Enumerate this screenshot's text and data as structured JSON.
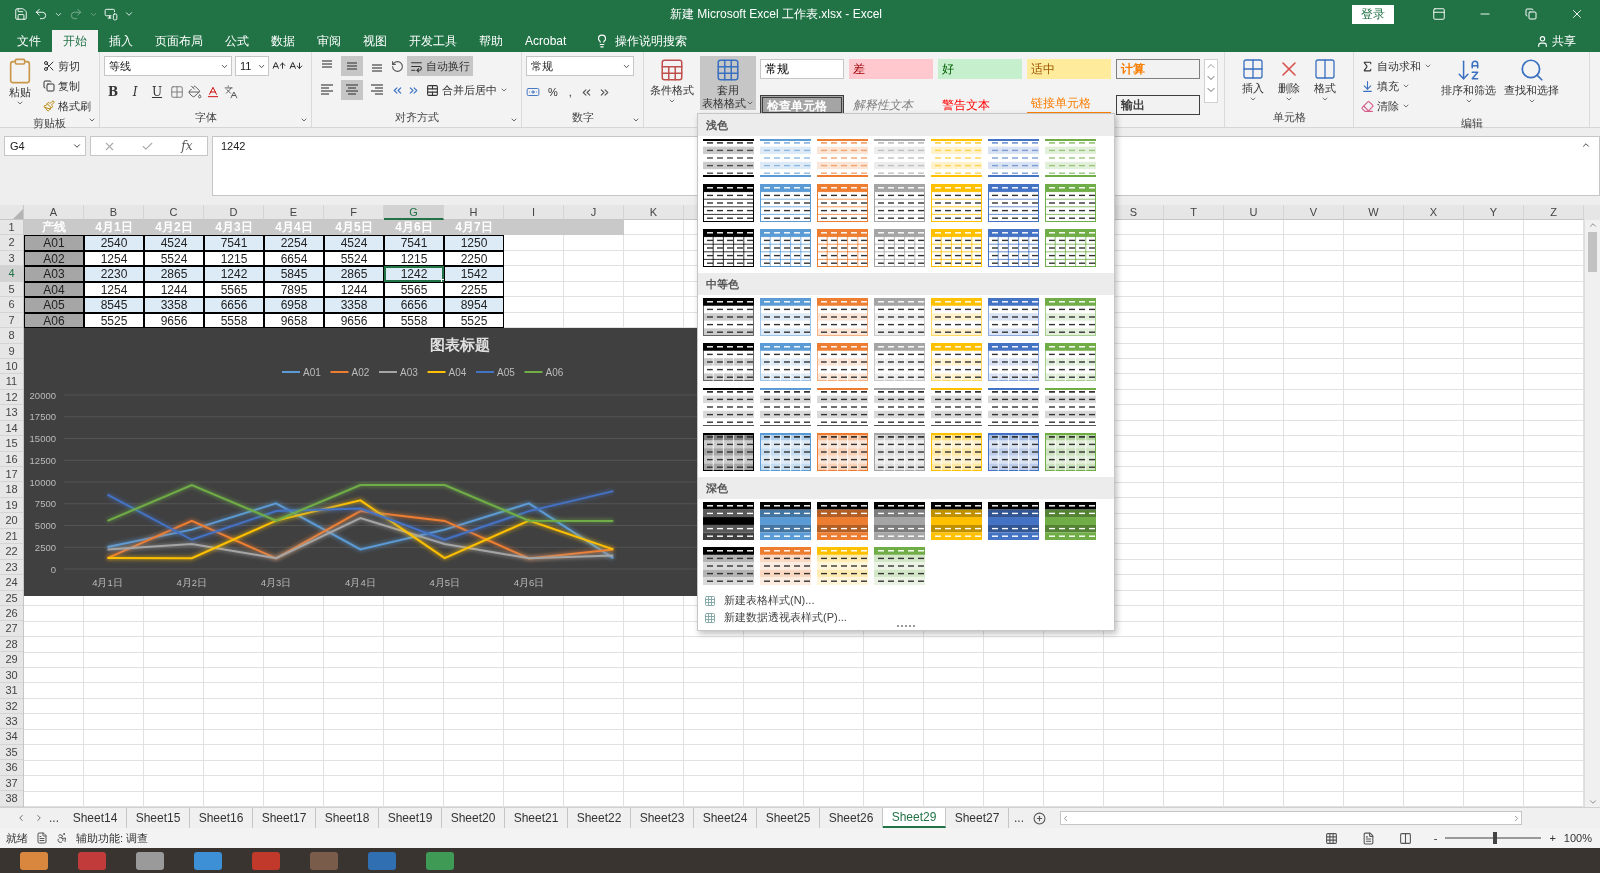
{
  "window": {
    "title": "新建 Microsoft Excel 工作表.xlsx  -  Excel",
    "sign_in": "登录"
  },
  "menu_tabs": [
    {
      "label": "文件",
      "selected": false
    },
    {
      "label": "开始",
      "selected": true
    },
    {
      "label": "插入",
      "selected": false
    },
    {
      "label": "页面布局",
      "selected": false
    },
    {
      "label": "公式",
      "selected": false
    },
    {
      "label": "数据",
      "selected": false
    },
    {
      "label": "审阅",
      "selected": false
    },
    {
      "label": "视图",
      "selected": false
    },
    {
      "label": "开发工具",
      "selected": false
    },
    {
      "label": "帮助",
      "selected": false
    },
    {
      "label": "Acrobat",
      "selected": false
    }
  ],
  "tell_me": "操作说明搜索",
  "share": "共享",
  "ribbon": {
    "clipboard": {
      "label": "剪贴板",
      "paste": "粘贴",
      "cut": "剪切",
      "copy": "复制",
      "format_painter": "格式刷"
    },
    "font": {
      "label": "字体",
      "font_name": "等线",
      "font_size": "11",
      "bold": "B",
      "italic": "I",
      "underline": "U"
    },
    "alignment": {
      "label": "对齐方式",
      "vertical": [
        {
          "kind": "top",
          "on": false
        },
        {
          "kind": "middle",
          "on": true
        },
        {
          "kind": "bottom",
          "on": false
        }
      ],
      "horizontal": [
        {
          "kind": "left",
          "on": false
        },
        {
          "kind": "center",
          "on": true
        },
        {
          "kind": "right",
          "on": false
        }
      ],
      "wrap_text": {
        "label": "自动换行",
        "on": true
      },
      "merge_center": "合并后居中"
    },
    "number": {
      "label": "数字",
      "format": "常规",
      "percent": "%",
      "comma": ","
    },
    "styles": {
      "conditional": "条件格式",
      "format_as_table": {
        "line1": "套用",
        "line2": "表格格式",
        "on": true
      },
      "cell_styles": [
        {
          "label": "常规",
          "kind": "normal"
        },
        {
          "label": "差",
          "kind": "bad"
        },
        {
          "label": "好",
          "kind": "good"
        },
        {
          "label": "适中",
          "kind": "neutral"
        },
        {
          "label": "计算",
          "kind": "calculation"
        },
        {
          "label": "检查单元格",
          "kind": "check"
        },
        {
          "label": "解释性文本",
          "kind": "explanatory"
        },
        {
          "label": "警告文本",
          "kind": "warning"
        },
        {
          "label": "链接单元格",
          "kind": "linked"
        },
        {
          "label": "输出",
          "kind": "output"
        }
      ]
    },
    "cells": {
      "label": "单元格",
      "insert": "插入",
      "delete": "删除",
      "format": "格式"
    },
    "editing": {
      "label": "编辑",
      "autosum": "自动求和",
      "fill": "填充",
      "clear": "清除",
      "sort_filter": "排序和筛选",
      "find_select": "查找和选择"
    }
  },
  "formula_bar": {
    "name_box": "G4",
    "function_label": "fx",
    "value": "1242"
  },
  "column_headers": [
    {
      "label": "A",
      "selected": false
    },
    {
      "label": "B",
      "selected": false
    },
    {
      "label": "C",
      "selected": false
    },
    {
      "label": "D",
      "selected": false
    },
    {
      "label": "E",
      "selected": false
    },
    {
      "label": "F",
      "selected": false
    },
    {
      "label": "G",
      "selected": true
    },
    {
      "label": "H",
      "selected": false
    },
    {
      "label": "I",
      "selected": false
    },
    {
      "label": "J",
      "selected": false
    },
    {
      "label": "K",
      "selected": false
    }
  ],
  "column_headers_right": [
    {
      "label": "S",
      "selected": false
    },
    {
      "label": "T",
      "selected": false
    },
    {
      "label": "U",
      "selected": false
    },
    {
      "label": "V",
      "selected": false
    },
    {
      "label": "W",
      "selected": false
    },
    {
      "label": "X",
      "selected": false
    },
    {
      "label": "Y",
      "selected": false
    },
    {
      "label": "Z",
      "selected": false
    }
  ],
  "row_headers": [
    {
      "label": "1",
      "selected": false
    },
    {
      "label": "2",
      "selected": false
    },
    {
      "label": "3",
      "selected": false
    },
    {
      "label": "4",
      "selected": true
    },
    {
      "label": "5",
      "selected": false
    },
    {
      "label": "6",
      "selected": false
    },
    {
      "label": "7",
      "selected": false
    },
    {
      "label": "8",
      "selected": false
    },
    {
      "label": "9",
      "selected": false
    },
    {
      "label": "10",
      "selected": false
    },
    {
      "label": "11",
      "selected": false
    },
    {
      "label": "12",
      "selected": false
    },
    {
      "label": "13",
      "selected": false
    },
    {
      "label": "14",
      "selected": false
    },
    {
      "label": "15",
      "selected": false
    },
    {
      "label": "16",
      "selected": false
    },
    {
      "label": "17",
      "selected": false
    },
    {
      "label": "18",
      "selected": false
    },
    {
      "label": "19",
      "selected": false
    },
    {
      "label": "20",
      "selected": false
    },
    {
      "label": "21",
      "selected": false
    },
    {
      "label": "22",
      "selected": false
    },
    {
      "label": "23",
      "selected": false
    },
    {
      "label": "24",
      "selected": false
    },
    {
      "label": "25",
      "selected": false
    },
    {
      "label": "26",
      "selected": false
    },
    {
      "label": "27",
      "selected": false
    },
    {
      "label": "28",
      "selected": false
    },
    {
      "label": "29",
      "selected": false
    },
    {
      "label": "30",
      "selected": false
    },
    {
      "label": "31",
      "selected": false
    },
    {
      "label": "32",
      "selected": false
    },
    {
      "label": "33",
      "selected": false
    },
    {
      "label": "34",
      "selected": false
    },
    {
      "label": "35",
      "selected": false
    },
    {
      "label": "36",
      "selected": false
    },
    {
      "label": "37",
      "selected": false
    },
    {
      "label": "38",
      "selected": false
    }
  ],
  "table": {
    "header": [
      "产线",
      "4月1日",
      "4月2日",
      "4月3日",
      "4月4日",
      "4月5日",
      "4月6日",
      "4月7日"
    ],
    "rows": [
      {
        "cells": [
          {
            "text": "A01",
            "selected": false
          },
          {
            "text": "2540",
            "selected": false
          },
          {
            "text": "4524",
            "selected": false
          },
          {
            "text": "7541",
            "selected": false
          },
          {
            "text": "2254",
            "selected": false
          },
          {
            "text": "4524",
            "selected": false
          },
          {
            "text": "7541",
            "selected": false
          },
          {
            "text": "1250",
            "selected": false
          }
        ]
      },
      {
        "cells": [
          {
            "text": "A02",
            "selected": false
          },
          {
            "text": "1254",
            "selected": false
          },
          {
            "text": "5524",
            "selected": false
          },
          {
            "text": "1215",
            "selected": false
          },
          {
            "text": "6654",
            "selected": false
          },
          {
            "text": "5524",
            "selected": false
          },
          {
            "text": "1215",
            "selected": false
          },
          {
            "text": "2250",
            "selected": false
          }
        ]
      },
      {
        "cells": [
          {
            "text": "A03",
            "selected": false
          },
          {
            "text": "2230",
            "selected": false
          },
          {
            "text": "2865",
            "selected": false
          },
          {
            "text": "1242",
            "selected": false
          },
          {
            "text": "5845",
            "selected": false
          },
          {
            "text": "2865",
            "selected": false
          },
          {
            "text": "1242",
            "selected": true
          },
          {
            "text": "1542",
            "selected": false
          }
        ]
      },
      {
        "cells": [
          {
            "text": "A04",
            "selected": false
          },
          {
            "text": "1254",
            "selected": false
          },
          {
            "text": "1244",
            "selected": false
          },
          {
            "text": "5565",
            "selected": false
          },
          {
            "text": "7895",
            "selected": false
          },
          {
            "text": "1244",
            "selected": false
          },
          {
            "text": "5565",
            "selected": false
          },
          {
            "text": "2255",
            "selected": false
          }
        ]
      },
      {
        "cells": [
          {
            "text": "A05",
            "selected": false
          },
          {
            "text": "8545",
            "selected": false
          },
          {
            "text": "3358",
            "selected": false
          },
          {
            "text": "6656",
            "selected": false
          },
          {
            "text": "6958",
            "selected": false
          },
          {
            "text": "3358",
            "selected": false
          },
          {
            "text": "6656",
            "selected": false
          },
          {
            "text": "8954",
            "selected": false
          }
        ]
      },
      {
        "cells": [
          {
            "text": "A06",
            "selected": false
          },
          {
            "text": "5525",
            "selected": false
          },
          {
            "text": "9656",
            "selected": false
          },
          {
            "text": "5558",
            "selected": false
          },
          {
            "text": "9658",
            "selected": false
          },
          {
            "text": "9656",
            "selected": false
          },
          {
            "text": "5558",
            "selected": false
          },
          {
            "text": "5525",
            "selected": false
          }
        ]
      }
    ]
  },
  "chart": {
    "chart_data": {
      "type": "line",
      "title": "图表标题",
      "categories": [
        "4月1日",
        "4月2日",
        "4月3日",
        "4月4日",
        "4月5日",
        "4月6日",
        null
      ],
      "grid": true,
      "legend": "top",
      "ylim": [
        0,
        20000
      ],
      "yticks": [
        0,
        2500,
        5000,
        7500,
        10000,
        12500,
        15000,
        17500,
        20000
      ],
      "series": [
        {
          "name": "A01",
          "color": "#5b9bd5",
          "values": [
            2540,
            4524,
            7541,
            2254,
            4524,
            7541,
            1250
          ]
        },
        {
          "name": "A02",
          "color": "#ed7d31",
          "values": [
            1254,
            5524,
            1215,
            6654,
            5524,
            1215,
            2250
          ]
        },
        {
          "name": "A03",
          "color": "#a5a5a5",
          "values": [
            2230,
            2865,
            1242,
            5845,
            2865,
            1242,
            1542
          ]
        },
        {
          "name": "A04",
          "color": "#ffc000",
          "values": [
            1254,
            1244,
            5565,
            7895,
            1244,
            5565,
            2255
          ]
        },
        {
          "name": "A05",
          "color": "#4472c4",
          "values": [
            8545,
            3358,
            6656,
            6958,
            3358,
            6656,
            8954
          ]
        },
        {
          "name": "A06",
          "color": "#70ad47",
          "values": [
            5525,
            9656,
            5558,
            9658,
            9656,
            5558,
            5525
          ]
        }
      ]
    }
  },
  "gallery": {
    "sections": [
      {
        "label": "浅色",
        "rows": [
          {
            "kind": "lines",
            "items": [
              {
                "color": "#000000"
              },
              {
                "color": "#5b9bd5"
              },
              {
                "color": "#ed7d31"
              },
              {
                "color": "#a5a5a5"
              },
              {
                "color": "#ffc000"
              },
              {
                "color": "#4472c4"
              },
              {
                "color": "#70ad47"
              }
            ]
          },
          {
            "kind": "header",
            "items": [
              {
                "color": "#000000"
              },
              {
                "color": "#5b9bd5"
              },
              {
                "color": "#ed7d31"
              },
              {
                "color": "#a5a5a5"
              },
              {
                "color": "#ffc000"
              },
              {
                "color": "#4472c4"
              },
              {
                "color": "#70ad47"
              }
            ]
          },
          {
            "kind": "grid",
            "items": [
              {
                "color": "#000000"
              },
              {
                "color": "#5b9bd5"
              },
              {
                "color": "#ed7d31"
              },
              {
                "color": "#a5a5a5"
              },
              {
                "color": "#ffc000"
              },
              {
                "color": "#4472c4"
              },
              {
                "color": "#70ad47"
              }
            ]
          }
        ]
      },
      {
        "label": "中等色",
        "rows": [
          {
            "kind": "banded",
            "items": [
              {
                "color": "#000000"
              },
              {
                "color": "#5b9bd5"
              },
              {
                "color": "#ed7d31"
              },
              {
                "color": "#a5a5a5"
              },
              {
                "color": "#ffc000"
              },
              {
                "color": "#4472c4"
              },
              {
                "color": "#70ad47"
              }
            ]
          },
          {
            "kind": "banded-grid",
            "items": [
              {
                "color": "#000000"
              },
              {
                "color": "#5b9bd5"
              },
              {
                "color": "#ed7d31"
              },
              {
                "color": "#a5a5a5"
              },
              {
                "color": "#ffc000"
              },
              {
                "color": "#4472c4"
              },
              {
                "color": "#70ad47"
              }
            ]
          },
          {
            "kind": "topbar",
            "items": [
              {
                "color": "#000000"
              },
              {
                "color": "#5b9bd5"
              },
              {
                "color": "#ed7d31"
              },
              {
                "color": "#a5a5a5"
              },
              {
                "color": "#ffc000"
              },
              {
                "color": "#4472c4"
              },
              {
                "color": "#70ad47"
              }
            ]
          },
          {
            "kind": "filled-grid",
            "items": [
              {
                "color": "#000000"
              },
              {
                "color": "#5b9bd5"
              },
              {
                "color": "#ed7d31"
              },
              {
                "color": "#a5a5a5"
              },
              {
                "color": "#ffc000"
              },
              {
                "color": "#4472c4"
              },
              {
                "color": "#70ad47"
              }
            ]
          }
        ]
      },
      {
        "label": "深色",
        "rows": [
          {
            "kind": "dark",
            "items": [
              {
                "color": "#000000"
              },
              {
                "color": "#5b9bd5"
              },
              {
                "color": "#ed7d31"
              },
              {
                "color": "#a5a5a5"
              },
              {
                "color": "#ffc000"
              },
              {
                "color": "#4472c4"
              },
              {
                "color": "#70ad47"
              }
            ]
          },
          {
            "kind": "dark-light",
            "items": [
              {
                "color": "#000000"
              },
              {
                "color": "#ed7d31"
              },
              {
                "color": "#ffc000"
              },
              {
                "color": "#70ad47"
              }
            ]
          }
        ]
      }
    ],
    "footer": [
      "新建表格样式(N)...",
      "新建数据透视表样式(P)..."
    ]
  },
  "sheet_tabs": {
    "more_left": "...",
    "more_right": "...",
    "tabs": [
      {
        "label": "Sheet14",
        "selected": false
      },
      {
        "label": "Sheet15",
        "selected": false
      },
      {
        "label": "Sheet16",
        "selected": false
      },
      {
        "label": "Sheet17",
        "selected": false
      },
      {
        "label": "Sheet18",
        "selected": false
      },
      {
        "label": "Sheet19",
        "selected": false
      },
      {
        "label": "Sheet20",
        "selected": false
      },
      {
        "label": "Sheet21",
        "selected": false
      },
      {
        "label": "Sheet22",
        "selected": false
      },
      {
        "label": "Sheet23",
        "selected": false
      },
      {
        "label": "Sheet24",
        "selected": false
      },
      {
        "label": "Sheet25",
        "selected": false
      },
      {
        "label": "Sheet26",
        "selected": false
      },
      {
        "label": "Sheet29",
        "selected": true
      },
      {
        "label": "Sheet27",
        "selected": false
      }
    ]
  },
  "status_bar": {
    "ready": "就绪",
    "accessibility": "辅助功能: 调查",
    "zoom_out": "-",
    "zoom_in": "+",
    "zoom": {
      "label": "100%",
      "level": 0.5
    }
  }
}
